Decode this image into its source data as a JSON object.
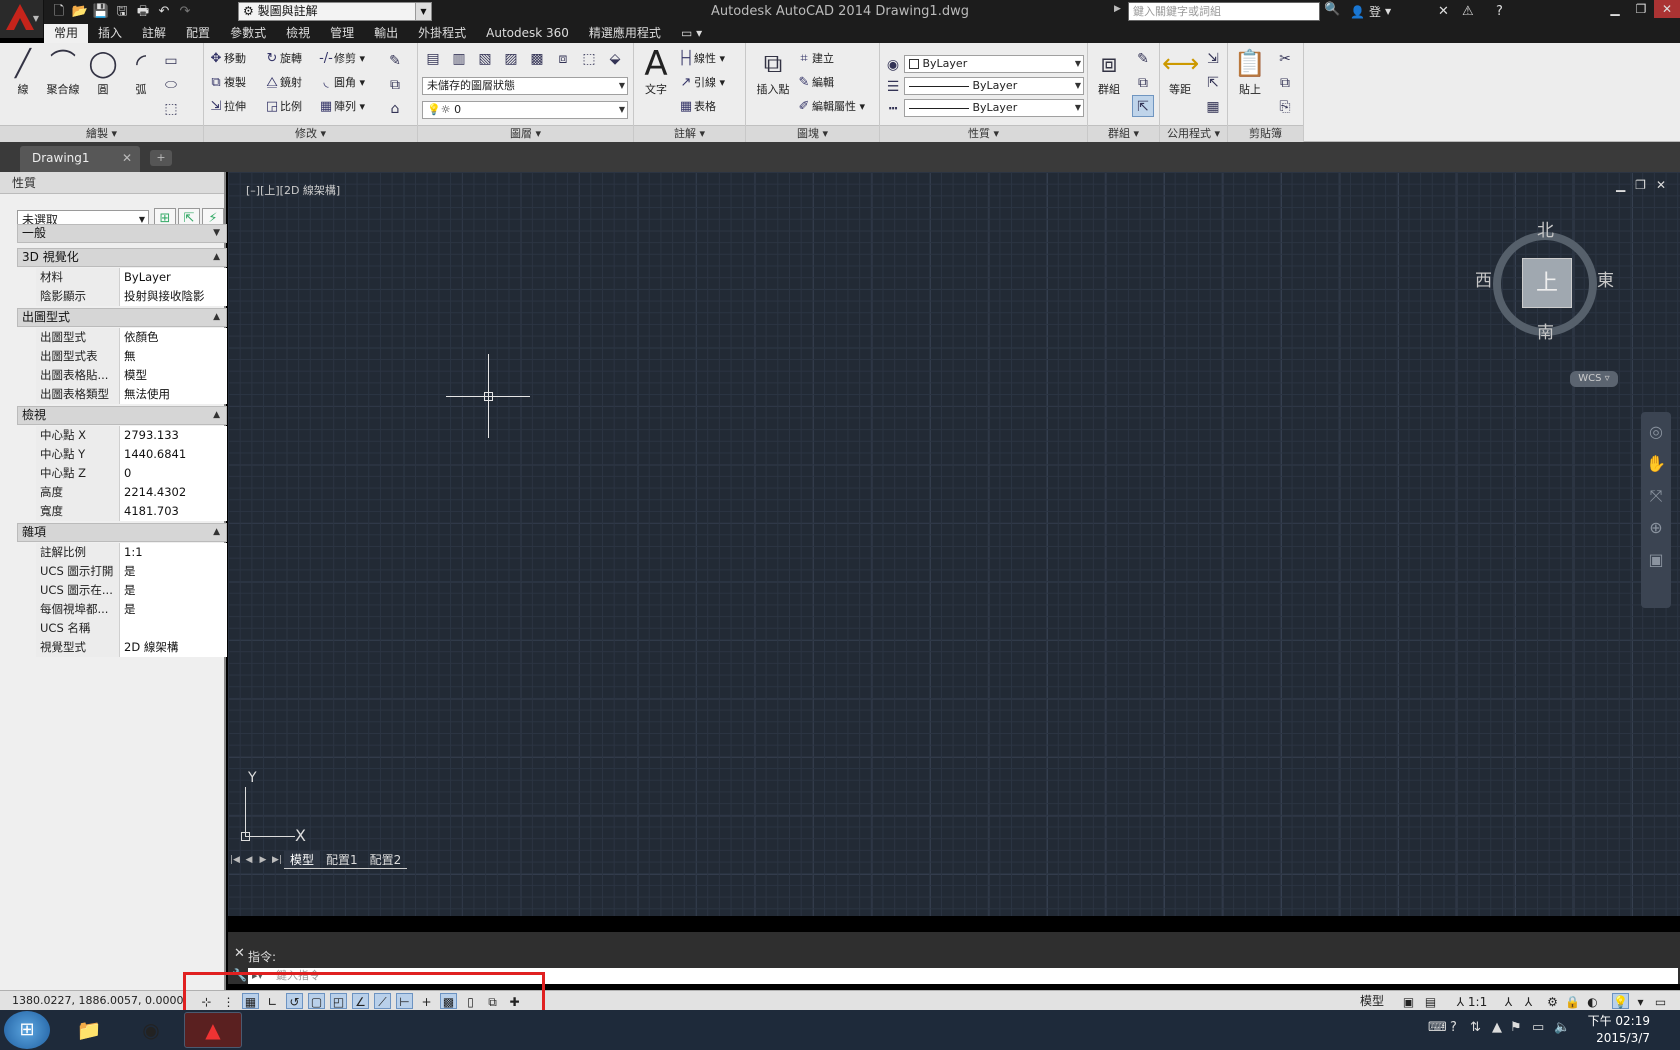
{
  "titlebar": {
    "window_title": "Autodesk AutoCAD 2014    Drawing1.dwg",
    "workspace": "製圖與註解",
    "search_placeholder": "鍵入關鍵字或詞組",
    "login": "登入"
  },
  "ribbon_tabs": [
    "常用",
    "插入",
    "註解",
    "配置",
    "參數式",
    "檢視",
    "管理",
    "輸出",
    "外掛程式",
    "Autodesk 360",
    "精選應用程式"
  ],
  "ribbon": {
    "draw": {
      "title": "繪製 ▾",
      "line": "線",
      "polyline": "聚合線",
      "circle": "圓",
      "arc": "弧"
    },
    "modify": {
      "title": "修改 ▾",
      "move": "移動",
      "rotate": "旋轉",
      "trim": "修剪",
      "copy": "複製",
      "mirror": "鏡射",
      "fillet": "圓角",
      "stretch": "拉伸",
      "scale": "比例",
      "array": "陣列"
    },
    "layers": {
      "title": "圖層 ▾",
      "layer_state": "未儲存的圖層狀態",
      "current_layer": "0"
    },
    "annotation": {
      "title": "註解 ▾",
      "text": "文字",
      "linear": "線性",
      "leader": "引線",
      "table": "表格"
    },
    "block": {
      "title": "圖塊 ▾",
      "insert": "插入點",
      "create": "建立",
      "edit": "編輯",
      "edit_attr": "編輯屬性"
    },
    "properties": {
      "title": "性質 ▾",
      "color": "ByLayer",
      "linetype": "ByLayer",
      "lineweight": "ByLayer"
    },
    "groups": {
      "title": "群組 ▾",
      "group": "群組"
    },
    "utilities": {
      "title": "公用程式 ▾",
      "measure": "等距"
    },
    "clipboard": {
      "title": "剪貼簿",
      "paste": "貼上"
    }
  },
  "file_tab": "Drawing1",
  "properties_palette": {
    "title": "性質",
    "selection": "未選取",
    "general": "一般",
    "sections": [
      {
        "name": "3D 視覺化",
        "rows": [
          [
            "材料",
            "ByLayer"
          ],
          [
            "陰影顯示",
            "投射與接收陰影"
          ]
        ]
      },
      {
        "name": "出圖型式",
        "rows": [
          [
            "出圖型式",
            "依顏色"
          ],
          [
            "出圖型式表",
            "無"
          ],
          [
            "出圖表格貼...",
            "模型"
          ],
          [
            "出圖表格類型",
            "無法使用"
          ]
        ]
      },
      {
        "name": "檢視",
        "rows": [
          [
            "中心點 X",
            "2793.133"
          ],
          [
            "中心點 Y",
            "1440.6841"
          ],
          [
            "中心點 Z",
            "0"
          ],
          [
            "高度",
            "2214.4302"
          ],
          [
            "寬度",
            "4181.703"
          ]
        ]
      },
      {
        "name": "雜項",
        "rows": [
          [
            "註解比例",
            "1:1"
          ],
          [
            "UCS 圖示打開",
            "是"
          ],
          [
            "UCS 圖示在...",
            "是"
          ],
          [
            "每個視埠都...",
            "是"
          ],
          [
            "UCS 名稱",
            ""
          ],
          [
            "視覺型式",
            "2D 線架構"
          ]
        ]
      }
    ]
  },
  "viewport": {
    "label": "[–][上][2D 線架構]",
    "viewcube": {
      "top": "上",
      "north": "北",
      "south": "南",
      "east": "東",
      "west": "西",
      "wcs": "WCS ▿"
    },
    "ucs_x": "X",
    "ucs_y": "Y",
    "layout_tabs": [
      "模型",
      "配置1",
      "配置2"
    ]
  },
  "command": {
    "history": "指令:",
    "placeholder": "鍵入指令"
  },
  "statusbar": {
    "coords": "1380.0227, 1886.0057, 0.0000",
    "model": "模型",
    "annoscale": "1:1"
  },
  "taskbar": {
    "time": "下午 02:19",
    "date": "2015/3/7"
  }
}
